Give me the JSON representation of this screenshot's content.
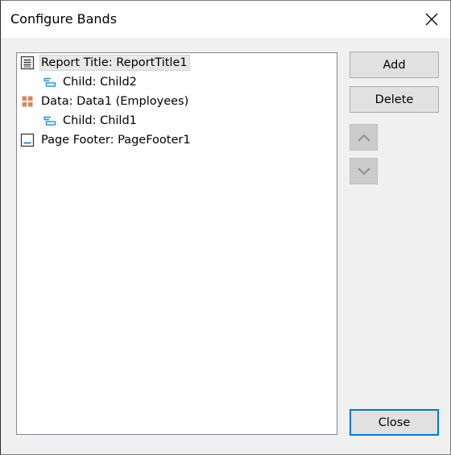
{
  "window": {
    "title": "Configure Bands"
  },
  "tree": {
    "items": [
      {
        "label": "Report Title: ReportTitle1",
        "icon": "report-title-band-icon",
        "level": 0,
        "selected": true
      },
      {
        "label": "Child: Child2",
        "icon": "child-band-icon",
        "level": 1,
        "selected": false
      },
      {
        "label": "Data: Data1 (Employees)",
        "icon": "data-band-icon",
        "level": 0,
        "selected": false
      },
      {
        "label": "Child: Child1",
        "icon": "child-band-icon",
        "level": 1,
        "selected": false
      },
      {
        "label": "Page Footer: PageFooter1",
        "icon": "page-footer-band-icon",
        "level": 0,
        "selected": false
      }
    ]
  },
  "buttons": {
    "add": "Add",
    "delete": "Delete",
    "move_up_icon": "chevron-up-icon",
    "move_down_icon": "chevron-down-icon",
    "close": "Close"
  },
  "colors": {
    "dialog_bg": "#f0f0f0",
    "accent_blue": "#0078d7",
    "child_icon_blue": "#1e90d8",
    "data_icon_orange": "#d9875a",
    "disabled_button": "#cccccc"
  }
}
